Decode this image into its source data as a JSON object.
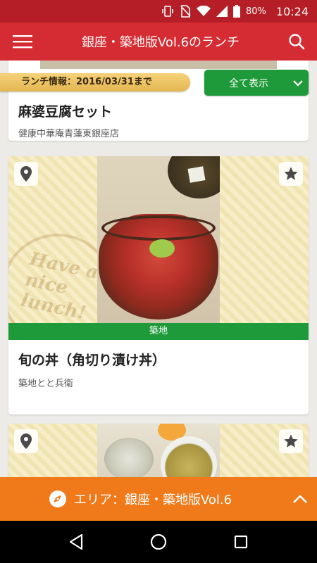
{
  "status": {
    "battery": "80%",
    "time": "10:24"
  },
  "appbar": {
    "title": "銀座・築地版Vol.6のランチ"
  },
  "banner": {
    "info": "ランチ情報：2016/03/31まで",
    "show_all": "全て表示"
  },
  "cards": [
    {
      "name": "麻婆豆腐セット",
      "shop": "健康中華庵青蓮東銀座店"
    },
    {
      "name": "旬の丼（角切り漬け丼）",
      "shop": "築地とと兵衛",
      "area": "築地",
      "stamp": "Have a nice lunch!"
    },
    {}
  ],
  "areabar": {
    "label": "エリア：銀座・築地版Vol.6"
  },
  "colors": {
    "statusbar": "#b51e26",
    "appbar": "#d52b32",
    "green": "#1f9a3a",
    "orange": "#f07a1a",
    "banner": "#f5d27a"
  }
}
